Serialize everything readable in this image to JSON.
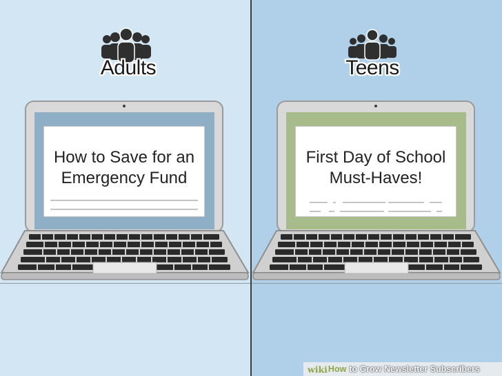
{
  "panels": [
    {
      "audience": "Adults",
      "card_title": "How to Save for an\nEmergency Fund",
      "screen_color": "#8fafc7"
    },
    {
      "audience": "Teens",
      "card_title": "First Day of School\nMust-Haves!",
      "screen_color": "#a7bc8a"
    }
  ],
  "watermark": {
    "wiki": "wiki",
    "how": "How",
    "rest": "to Grow Newsletter Subscribers"
  },
  "colors": {
    "left_background": "#d2e6f4",
    "right_background": "#afd0e8",
    "laptop_body": "#d6d6d6",
    "keys": "#2b2b2b"
  }
}
